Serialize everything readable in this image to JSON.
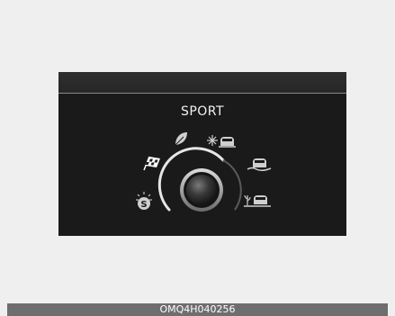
{
  "display": {
    "mode_title": "SPORT",
    "selected_mode": "sport",
    "knob_icons": [
      "checkered-flag-icon",
      "leaf-icon",
      "snowflake-car-icon",
      "mud-car-icon",
      "sand-car-icon",
      "smart-mode-icon"
    ],
    "colors": {
      "panel": "#1a1a1a",
      "text": "#f2f2f2",
      "icon": "#cfcfcf",
      "active_icon": "#ffffff"
    }
  },
  "caption": {
    "code": "OMQ4H040256"
  }
}
